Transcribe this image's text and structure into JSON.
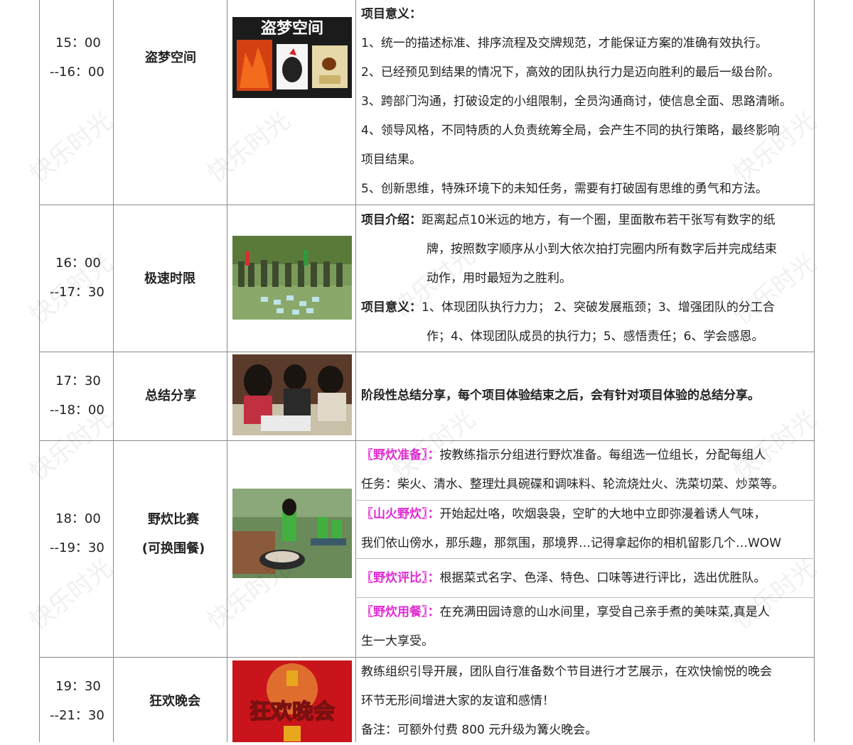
{
  "rows": [
    {
      "time_start": "15：00",
      "time_end": "--16：00",
      "name": "盗梦空间",
      "image_caption": "盗梦空间",
      "desc_title": "项目意义：",
      "desc_lines": [
        "1、统一的描述标准、排序流程及交牌规范，才能保证方案的准确有效执行。",
        "2、已经预见到结果的情况下，高效的团队执行力是迈向胜利的最后一级台阶。",
        "3、跨部门沟通，打破设定的小组限制，全员沟通商讨，使信息全面、思路清晰。",
        "4、领导风格，不同特质的人负责统筹全局，会产生不同的执行策略，最终影响",
        "项目结果。",
        "5、创新思维，特殊环境下的未知任务，需要有打破固有思维的勇气和方法。"
      ]
    },
    {
      "time_start": "16：00",
      "time_end": "--17：30",
      "name": "极速时限",
      "intro_label": "项目介绍：",
      "intro_lines": [
        "距离起点10米远的地方，有一个圈，里面散布若干张写有数字的纸",
        "牌，按照数字顺序从小到大依次拍打完圈内所有数字后并完成结束",
        "动作，用时最短为之胜利。"
      ],
      "meaning_label": "项目意义：",
      "meaning_lines": [
        "1、体现团队执行力力；  2、突破发展瓶颈；3、增强团队的分工合",
        "作；4、体现团队成员的执行力；5、感悟责任；6、学会感恩。"
      ]
    },
    {
      "time_start": "17：30",
      "time_end": "--18：00",
      "name": "总结分享",
      "desc": "阶段性总结分享，每个项目体验结束之后，会有针对项目体验的总结分享。"
    },
    {
      "time_start": "18：00",
      "time_end": "--19：30",
      "name": "野炊比赛",
      "name_sub": "(可换围餐)",
      "items": [
        {
          "tag": "〖野炊准备〗：",
          "lines": [
            "按教练指示分组进行野炊准备。每组选一位组长，分配每组人",
            "任务：柴火、清水、整理灶具碗碟和调味料、轮流烧灶火、洗菜切菜、炒菜等。"
          ]
        },
        {
          "tag": "〖山火野炊〗：",
          "lines": [
            "开始起灶咯，吹烟袅袅，空旷的大地中立即弥漫着诱人气味，",
            "我们依山傍水，那乐趣，那氛围，那境界…记得拿起你的相机留影几个…WOW"
          ]
        },
        {
          "tag": "〖野炊评比〗：",
          "lines": [
            "根据菜式名字、色泽、特色、口味等进行评比，选出优胜队。"
          ]
        },
        {
          "tag": "〖野炊用餐〗：",
          "lines": [
            "在充满田园诗意的山水间里，享受自己亲手煮的美味菜,真是人",
            "生一大享受。"
          ]
        }
      ]
    },
    {
      "time_start": "19：30",
      "time_end": "--21：30",
      "name": "狂欢晚会",
      "image_caption": "狂欢晚会",
      "desc_lines": [
        "教练组织引导开展，团队自行准备数个节目进行才艺展示，在欢快愉悦的晚会",
        "环节无形间增进大家的友谊和感情！",
        "备注：可额外付费 800 元升级为篝火晚会。"
      ]
    }
  ],
  "watermark": "快乐时光",
  "colors": {
    "tag": "#e02ad2",
    "border": "#8a8a8a"
  }
}
